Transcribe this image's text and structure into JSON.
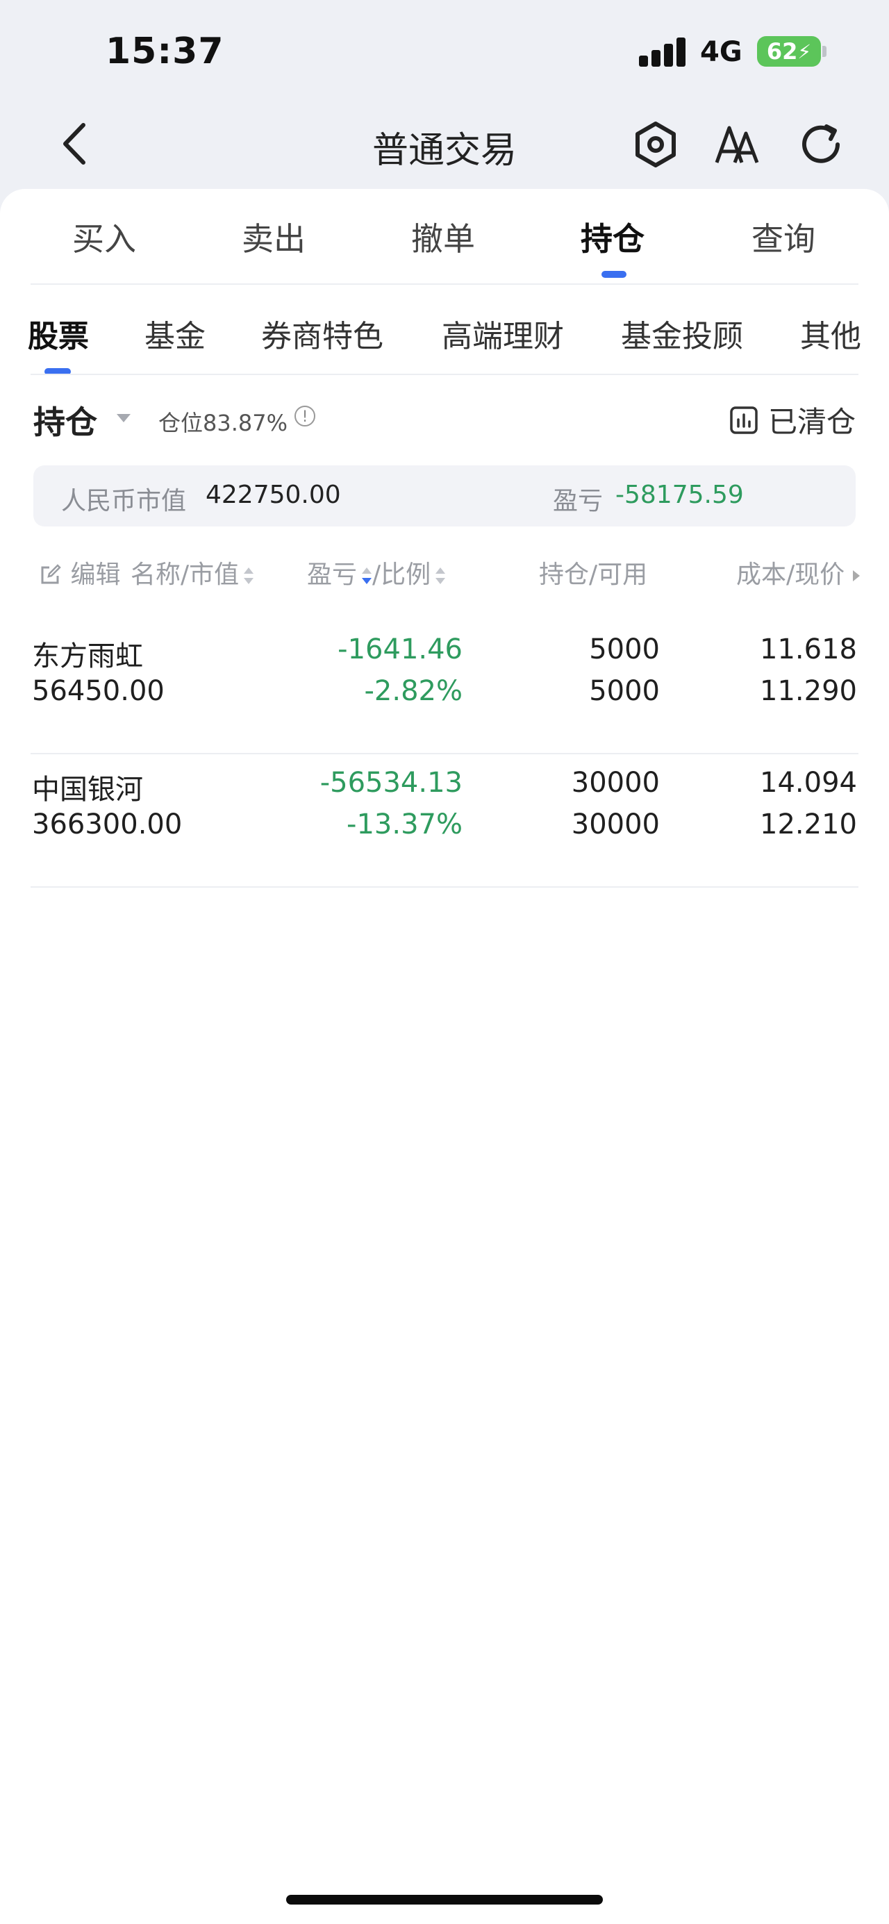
{
  "status_bar": {
    "time": "15:37",
    "network": "4G",
    "battery": "62"
  },
  "nav": {
    "title": "普通交易",
    "icons": [
      "back-icon",
      "settings-hexagon-icon",
      "font-size-icon",
      "refresh-icon"
    ]
  },
  "trade_tabs": [
    {
      "label": "买入"
    },
    {
      "label": "卖出"
    },
    {
      "label": "撤单"
    },
    {
      "label": "持仓"
    },
    {
      "label": "查询"
    }
  ],
  "active_trade_tab": "持仓",
  "asset_tabs": [
    {
      "label": "股票"
    },
    {
      "label": "基金"
    },
    {
      "label": "券商特色"
    },
    {
      "label": "高端理财"
    },
    {
      "label": "基金投顾"
    },
    {
      "label": "其他"
    }
  ],
  "active_asset_tab": "股票",
  "holdings_header": {
    "title": "持仓",
    "position_ratio": "仓位83.87%",
    "cleared_label": "已清仓"
  },
  "summary": {
    "market_value_label": "人民币市值",
    "market_value": "422750.00",
    "pnl_label": "盈亏",
    "pnl": "-58175.59"
  },
  "columns": {
    "edit": "编辑",
    "name": "名称/市值",
    "pnl_a": "盈亏",
    "pnl_b": "/比例",
    "holding": "持仓/可用",
    "cost": "成本/现价"
  },
  "rows": [
    {
      "name": "东方雨虹",
      "market_value": "56450.00",
      "pnl": "-1641.46",
      "pnl_ratio": "-2.82%",
      "holding": "5000",
      "available": "5000",
      "cost": "11.618",
      "price": "11.290"
    },
    {
      "name": "中国银河",
      "market_value": "366300.00",
      "pnl": "-56534.13",
      "pnl_ratio": "-13.37%",
      "holding": "30000",
      "available": "30000",
      "cost": "14.094",
      "price": "12.210"
    }
  ],
  "colors": {
    "accent": "#3a6ff0",
    "loss": "#2e9b5e",
    "battery": "#5cc55a"
  }
}
